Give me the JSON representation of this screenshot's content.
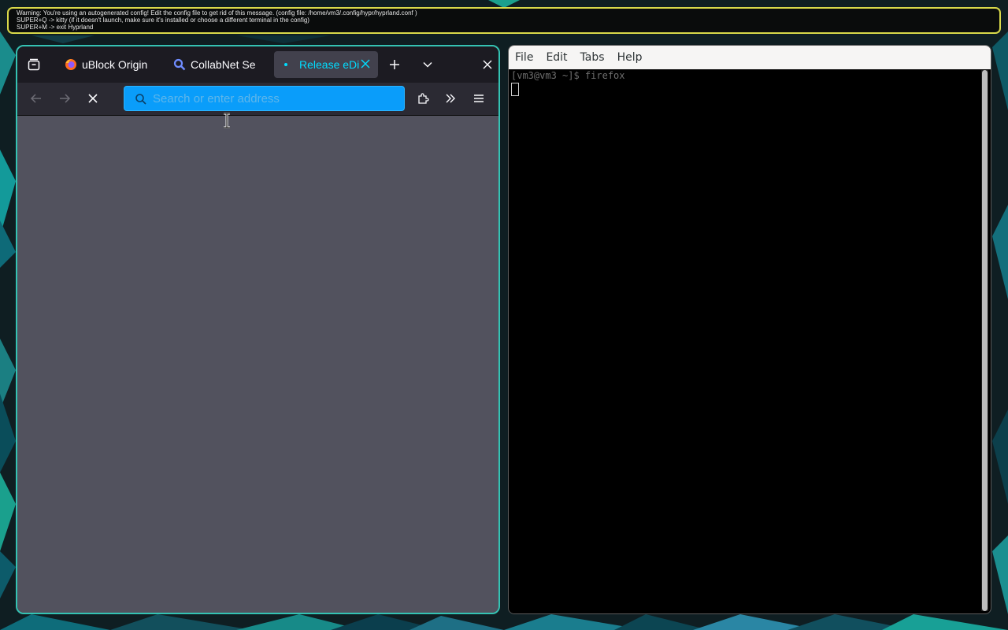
{
  "banner": {
    "lines": [
      "Warning: You're using an autogenerated config! Edit the config file to get rid of this message. (config file: /home/vm3/.config/hypr/hyprland.conf )",
      "SUPER+Q -> kitty (if it doesn't launch, make sure it's installed or choose a different terminal in the config)",
      "SUPER+M -> exit Hyprland"
    ]
  },
  "firefox": {
    "tabs": [
      {
        "title": "uBlock Origin",
        "icon": "firefox-icon",
        "active": false
      },
      {
        "title": "CollabNet Se",
        "icon": "search-icon",
        "active": false
      },
      {
        "title": "Release eDi",
        "icon": "loading-dot-icon",
        "active": true
      }
    ],
    "urlbar": {
      "placeholder": "Search or enter address",
      "value": ""
    },
    "colors": {
      "accent": "#00ddff",
      "urlbar": "#0a9dfa",
      "border": "#34c3b3"
    }
  },
  "terminal": {
    "menu": [
      "File",
      "Edit",
      "Tabs",
      "Help"
    ],
    "prompt_line": "[vm3@vm3 ~]$ firefox"
  }
}
